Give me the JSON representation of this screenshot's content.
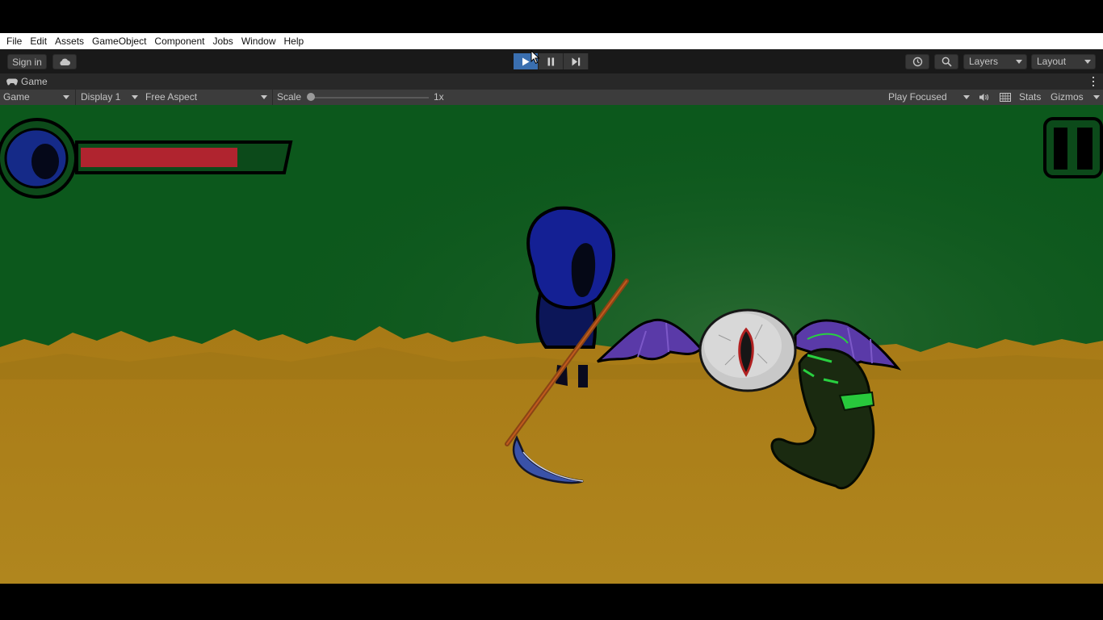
{
  "menubar": {
    "items": [
      "File",
      "Edit",
      "Assets",
      "GameObject",
      "Component",
      "Jobs",
      "Window",
      "Help"
    ]
  },
  "toolbar": {
    "sign_in_label": "Sign in",
    "cloud_icon": "cloud-icon",
    "play_state": "playing",
    "history_icon": "history-icon",
    "search_icon": "search-icon",
    "layers_label": "Layers",
    "layout_label": "Layout",
    "accent_color": "#3a6fb0"
  },
  "game_window": {
    "tab_label": "Game",
    "tab_icon": "gamepad-icon",
    "view_mode": "Game",
    "display": "Display 1",
    "aspect": "Free Aspect",
    "scale_label": "Scale",
    "scale_value": "1x",
    "play_mode_option": "Play Focused",
    "stats_label": "Stats",
    "gizmos_label": "Gizmos"
  },
  "game": {
    "player_health_fraction": 0.77,
    "health_color": "#b0242f",
    "sky_color": "#0c5a1c",
    "ground_color": "#b0821c",
    "pause_icon": "pause-icon"
  }
}
